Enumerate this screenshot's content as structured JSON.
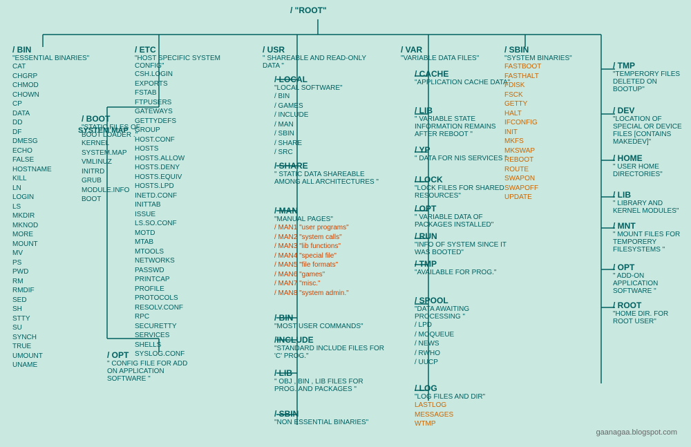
{
  "root": {
    "label": "/   \"ROOT\""
  },
  "nodes": {
    "bin": {
      "title": "/ BIN",
      "desc": "\"ESSENTIAL BINARIES\"",
      "items": [
        "CAT",
        "CHGRP",
        "CHMOD",
        "CHOWN",
        "CP",
        "DATA",
        "DD",
        "DF",
        "DMESG",
        "ECHO",
        "FALSE",
        "HOSTNAME",
        "KILL",
        "LN",
        "LOGIN",
        "LS",
        "MKDIR",
        "MKNOD",
        "MORE",
        "MOUNT",
        "MV",
        "PS",
        "PWD",
        "RM",
        "RMDIF",
        "SED",
        "SH",
        "STTY",
        "SU",
        "SYNCH",
        "TRUE",
        "UMOUNT",
        "UNAME"
      ]
    },
    "etc": {
      "title": "/ ETC",
      "desc": "\"HOST SPECIFIC SYSTEM CONFIG\"",
      "items": [
        "CSH.LOGIN",
        "EXPORTS",
        "FSTAB",
        "FTPUSERS",
        "GATEWAYS",
        "GETTYDEFS",
        "GROUP",
        "HOST.CONF",
        "HOSTS",
        "HOSTS.ALLOW",
        "HOSTS.DENY",
        "HOSTS.EQUIV",
        "HOSTS.LPD",
        "INETD.CONF",
        "INITTAB",
        "ISSUE",
        "LS.SO.CONF",
        "MOTD",
        "MTAB",
        "MTOOLS",
        "NETWORKS",
        "PASSWD",
        "PRINTCAP",
        "PROFILE",
        "PROTOCOLS",
        "RESOLV.CONF",
        "RPC",
        "SECURETTY",
        "SERVICES",
        "SHELLS",
        "SYSLOG.CONF"
      ]
    },
    "etc_opt": {
      "title": "/ OPT",
      "desc": "\" CONFIG FILE FOR ADD ON APPLICATION SOFTWARE \""
    },
    "boot": {
      "title": "/ BOOT",
      "desc": "\"STATIC FILES OF BOOT LOADER .\"",
      "items": [
        "KERNEL",
        "SYSTEM.MAP",
        "VMLINUZ",
        "INITRD",
        "GRUB",
        "MODULE.INFO",
        "BOOT"
      ]
    },
    "usr": {
      "title": "/ USR",
      "desc": "\" SHAREABLE AND READ-ONLY DATA \""
    },
    "usr_local": {
      "title": "/ LOCAL",
      "desc": "\"LOCAL SOFTWARE\"",
      "subitems": [
        "/ BIN",
        "/ GAMES",
        "/ INCLUDE",
        "/ MAN",
        "/ SBIN",
        "/ SHARE",
        "/ SRC"
      ]
    },
    "usr_share": {
      "title": "/ SHARE",
      "desc": "\" STATIC DATA SHAREABLE AMONG ALL ARCHITECTURES \""
    },
    "usr_man": {
      "title": "/ MAN",
      "desc": "\"MANUAL PAGES\"",
      "subitems": [
        "/ MAN1 \"user programs\"",
        "/ MAN2 \"system calls\"",
        "/ MAN3 \"lib functions\"",
        "/ MAN4 \"special file\"",
        "/ MAN5 \"file formats\"",
        "/ MAN6 \"games\"",
        "/ MAN7 \"misc.\"",
        "/ MAN8 \"system admin.\""
      ]
    },
    "usr_bin": {
      "title": "/ BIN",
      "desc": "\"MOST USER COMMANDS\""
    },
    "usr_include": {
      "title": "/INCLUDE",
      "desc": "\"STANDARD INCLUDE FILES FOR 'C' PROG.\""
    },
    "usr_lib": {
      "title": "/ LIB",
      "desc": "\" OBJ , BIN , LIB FILES FOR PROG. AND PACKAGES \""
    },
    "usr_sbin": {
      "title": "/ SBIN",
      "desc": "\"NON ESSENTIAL BINARIES\""
    },
    "var": {
      "title": "/ VAR",
      "desc": "\"VARIABLE DATA FILES\""
    },
    "var_cache": {
      "title": "/ CACHE",
      "desc": "\"APPLICATION CACHE DATA\""
    },
    "var_lib": {
      "title": "/ LIB",
      "desc": "\" VARIABLE STATE INFORMATION REMAINS AFTER REBOOT \""
    },
    "var_yp": {
      "title": "/ YP",
      "desc": "\" DATA FOR NIS SERVICES \""
    },
    "var_lock": {
      "title": "/ LOCK",
      "desc": "\"LOCK FILES FOR SHARED RESOURCES\""
    },
    "var_opt": {
      "title": "/ OPT",
      "desc": "\" VARIABLE DATA OF PACKAGES INSTALLED\""
    },
    "var_run": {
      "title": "/ RUN",
      "desc": "\"INFO OF SYSTEM SINCE IT WAS BOOTED\""
    },
    "var_tmp": {
      "title": "/ TMP",
      "desc": "\"AVAILABLE FOR PROG.\""
    },
    "var_spool": {
      "title": "/ SPOOL",
      "desc": "\"DATA AWAITING PROCESSING \"",
      "subitems": [
        "/ LPD",
        "/ MOQUEUE",
        "/ NEWS",
        "/ RWHO",
        "/ UUCP"
      ]
    },
    "var_log": {
      "title": "/ LOG",
      "desc": "\"LOG FILES AND DIR\"",
      "highlight_items": [
        "LASTLOG",
        "MESSAGES",
        "WTMP"
      ]
    },
    "sbin": {
      "title": "/ SBIN",
      "desc": "\"SYSTEM BINARIES\"",
      "highlight_items": [
        "FASTBOOT",
        "FASTHALT",
        "FDISK",
        "FSCK",
        "GETTY",
        "HALT",
        "IFCONFIG",
        "INIT",
        "MKFS",
        "MKSWAP",
        "REBOOT",
        "ROUTE",
        "SWAPON",
        "SWAPOFF",
        "UPDATE"
      ]
    },
    "tmp": {
      "title": "/ TMP",
      "desc": "\"TEMPERORY FILES DELETED ON BOOTUP\""
    },
    "dev": {
      "title": "/ DEV",
      "desc": "\"LOCATION OF SPECIAL OR DEVICE FILES [CONTAINS MAKEDEV]\""
    },
    "home": {
      "title": "/ HOME",
      "desc": "\" USER HOME DIRECTORIES\""
    },
    "lib": {
      "title": "/ LIB",
      "desc": "\"  LIBRARY AND KERNEL MODULES\""
    },
    "mnt": {
      "title": "/ MNT",
      "desc": "\"  MOUNT FILES FOR TEMPORERY FILESYSTEMS \""
    },
    "opt": {
      "title": "/ OPT",
      "desc": "\" ADD-ON APPLICATION SOFTWARE \""
    },
    "root_home": {
      "title": "/ ROOT",
      "desc": "\"HOME DIR. FOR ROOT USER\""
    },
    "system_map": {
      "label": "SYSTEM MAP"
    }
  },
  "watermark": "gaanagaa.blogspot.com"
}
